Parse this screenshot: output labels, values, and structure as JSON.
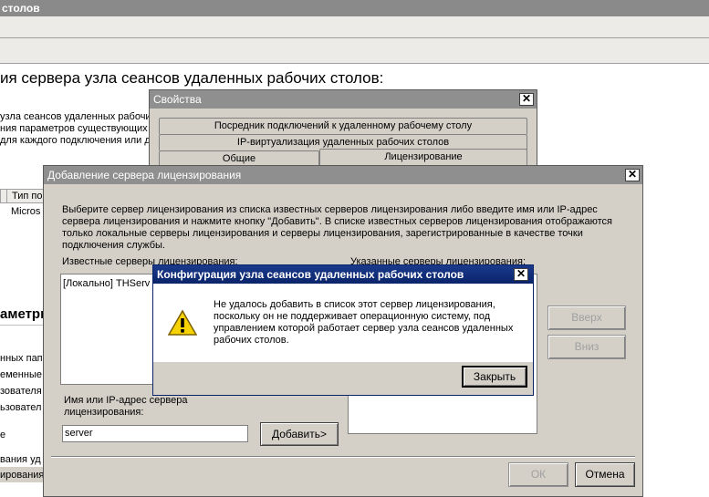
{
  "background_window": {
    "title": "столов",
    "heading": "ия сервера узла сеансов удаленных рабочих столов:",
    "desc_lines": [
      "узла сеансов удаленных рабочих",
      "ния параметров существующих",
      "для каждого подключения или д"
    ],
    "table_header": "Тип по",
    "table_cell": "Micros",
    "section_title": "аметры",
    "list_items": [
      "нных папо",
      "еменные",
      "зователя",
      "ьзовател",
      "е",
      "вания уд",
      "ирования"
    ]
  },
  "properties_dialog": {
    "title": "Свойства",
    "tabs": [
      "Посредник подключений к удаленному рабочему столу",
      "IP-виртуализация удаленных рабочих столов",
      "Общие",
      "Лицензирование"
    ]
  },
  "license_dialog": {
    "title": "Добавление сервера лицензирования",
    "description": "Выберите сервер лицензирования из списка известных серверов лицензирования либо введите имя или IP-адрес сервера лицензирования и нажмите кнопку \"Добавить\". В списке известных серверов лицензирования отображаются только локальные серверы лицензирования и серверы лицензирования, зарегистрированные в качестве точки подключения службы.",
    "known_label": "Известные серверы лицензирования:",
    "known_items": [
      "[Локально] THServ"
    ],
    "specified_label": "Указанные серверы лицензирования:",
    "name_label": "Имя или IP-адрес сервера лицензирования:",
    "name_value": "server",
    "add_button": "Добавить>",
    "up_button": "Вверх",
    "down_button": "Вниз",
    "ok_button": "ОК",
    "cancel_button": "Отмена"
  },
  "error_dialog": {
    "title": "Конфигурация узла сеансов удаленных рабочих столов",
    "message": "Не удалось добавить в список этот сервер лицензирования, поскольку он не поддерживает операционную систему, под управлением которой работает сервер узла сеансов удаленных рабочих столов.",
    "close_button": "Закрыть",
    "icon": "warning-icon"
  }
}
